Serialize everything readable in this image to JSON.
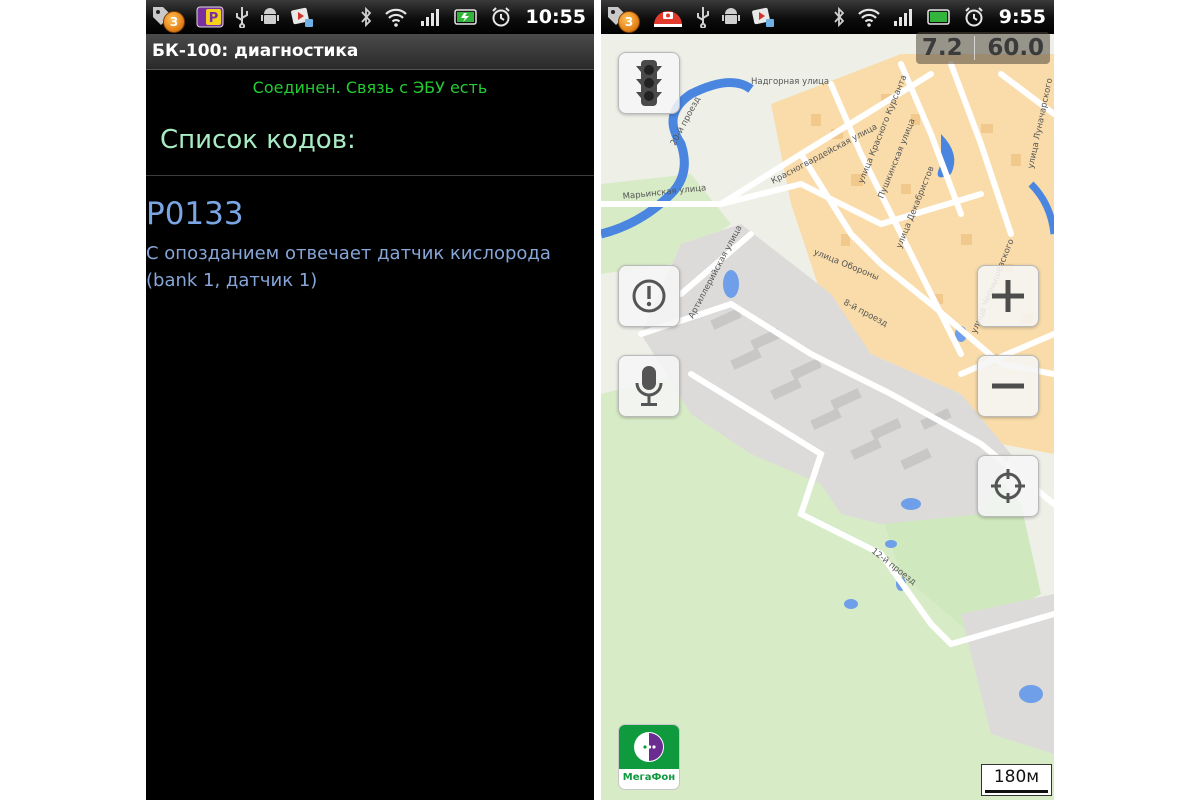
{
  "left_screen": {
    "status_bar": {
      "notification_count": "3",
      "parking_label": "P",
      "time": "10:55"
    },
    "title": "БК-100: диагностика",
    "connection_status": "Соединен. Связь с ЭБУ есть",
    "codes_header": "Список кодов:",
    "codes": [
      {
        "code": "P0133",
        "description": "С опозданием отвечает датчик кислорода (bank 1, датчик 1)"
      }
    ]
  },
  "right_screen": {
    "status_bar": {
      "notification_count": "3",
      "time": "9:55"
    },
    "speed_left": "7.2",
    "speed_right": "60.0",
    "street_labels": [
      "Надгорная улица",
      "20-й проезд",
      "Марьинская улица",
      "Красногвардейская улица",
      "улица Красного Курсанта",
      "Пушкинская улица",
      "улица Декабристов",
      "улица Луначарского",
      "Артиллерийская улица",
      "улица Обороны",
      "8-й проезд",
      "12-й проезд",
      "улица Чернышевского"
    ],
    "operator_logo_text": "МегаФон",
    "scale_label": "180м"
  },
  "colors": {
    "connected_green": "#22cc33",
    "header_mint": "#a9ecc4",
    "code_blue": "#7aa6e3",
    "map_residential": "#f9dcaa",
    "map_park": "#cfe8bd",
    "map_industrial": "#dddbd9",
    "map_water": "#4a86e0",
    "operator_green": "#0f9a3e"
  },
  "icons": [
    "notification-icon",
    "parking-icon",
    "usb-icon",
    "android-debug-icon",
    "media-icon",
    "bluetooth-icon",
    "wifi-icon",
    "signal-icon",
    "battery-icon",
    "alarm-icon",
    "speed-camera-icon",
    "traffic-light-icon",
    "alert-icon",
    "microphone-icon",
    "zoom-in-icon",
    "zoom-out-icon",
    "locate-icon"
  ]
}
